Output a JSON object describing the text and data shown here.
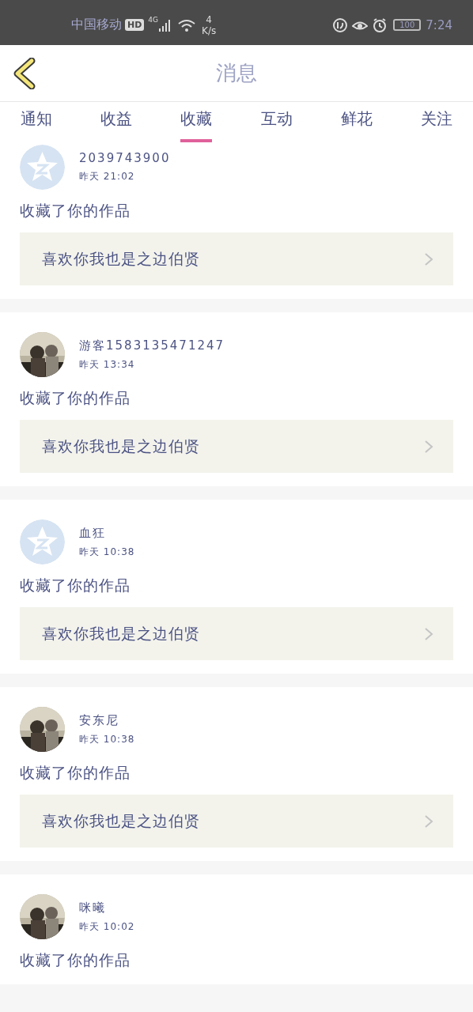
{
  "status_bar": {
    "carrier": "中国移动",
    "hd": "HD",
    "network": "4G",
    "speed_value": "4",
    "speed_unit": "K/s",
    "battery": "100",
    "time": "7:24"
  },
  "header": {
    "title": "消息"
  },
  "tabs": [
    {
      "label": "通知",
      "selected": false
    },
    {
      "label": "收益",
      "selected": false
    },
    {
      "label": "收藏",
      "selected": true
    },
    {
      "label": "互动",
      "selected": false
    },
    {
      "label": "鲜花",
      "selected": false
    },
    {
      "label": "关注",
      "selected": false
    }
  ],
  "messages": [
    {
      "avatar": {
        "kind": "default"
      },
      "name": "2039743900",
      "time": "昨天 21:02",
      "action": "收藏了你的作品",
      "work": "喜欢你我也是之边伯贤"
    },
    {
      "name": "游客1583135471247",
      "time": "昨天 13:34",
      "action": "收藏了你的作品",
      "work": "喜欢你我也是之边伯贤"
    },
    {
      "avatar": {
        "kind": "default"
      },
      "name": "血狂",
      "time": "昨天 10:38",
      "action": "收藏了你的作品",
      "work": "喜欢你我也是之边伯贤"
    },
    {
      "name": "安东尼",
      "time": "昨天 10:38",
      "action": "收藏了你的作品",
      "work": "喜欢你我也是之边伯贤"
    },
    {
      "name": "咪曦",
      "time": "昨天 10:02",
      "action": "收藏了你的作品"
    }
  ]
}
